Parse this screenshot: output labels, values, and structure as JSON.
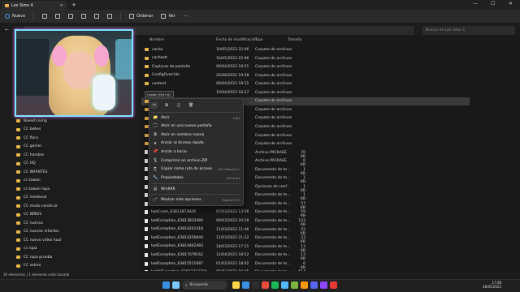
{
  "window": {
    "tab_title": "Los Sims 4",
    "tab_close": "✕",
    "new_tab": "+",
    "minimize": "—",
    "maximize": "☐",
    "close": "✕"
  },
  "commandbar": {
    "new_label": "Nuevo",
    "sort_label": "Ordenar",
    "view_label": "Ver",
    "more_label": "···"
  },
  "address": {
    "path": "",
    "search_placeholder": "Buscar en Los Sims 4"
  },
  "columns": {
    "name": "Nombre",
    "date": "Fecha de modificación",
    "type": "Tipo",
    "size": "Tamaño"
  },
  "sidebar": {
    "items": [
      "Boxed Living",
      "CC bebes",
      "CC flora",
      "CC gamer",
      "CC hombre",
      "CC HQ",
      "CC INFANTES",
      "cc kawaii",
      "cc kawaii ropa",
      "CC medieval",
      "CC modo construir",
      "CC NIÑOS",
      "CC nuevos",
      "CC nuevos infantes",
      "CC nuevo video haul",
      "cc ropa",
      "CC ropa prueba",
      "CC solero"
    ]
  },
  "files": [
    {
      "name": "cache",
      "date": "10/05/2023 22:06",
      "type": "Carpeta de archivos",
      "size": "",
      "kind": "folder"
    },
    {
      "name": "cachestr",
      "date": "10/05/2023 22:06",
      "type": "Carpeta de archivos",
      "size": "",
      "kind": "folder"
    },
    {
      "name": "Capturas de pantalla",
      "date": "06/04/2023 18:51",
      "type": "Carpeta de archivos",
      "size": "",
      "kind": "folder"
    },
    {
      "name": "ConfigOverride",
      "date": "26/08/2022 19:58",
      "type": "Carpeta de archivos",
      "size": "",
      "kind": "folder"
    },
    {
      "name": "content",
      "date": "06/04/2023 18:51",
      "type": "Carpeta de archivos",
      "size": "",
      "kind": "folder"
    },
    {
      "name": "",
      "date": "10/04/2023 16:27",
      "type": "Carpeta de archivos",
      "size": "",
      "kind": "folder"
    },
    {
      "name": "",
      "date": "",
      "type": "Carpeta de archivos",
      "size": "",
      "kind": "folder"
    },
    {
      "name": "",
      "date": "",
      "type": "Carpeta de archivos",
      "size": "",
      "kind": "folder"
    },
    {
      "name": "",
      "date": "",
      "type": "Carpeta de archivos",
      "size": "",
      "kind": "folder"
    },
    {
      "name": "",
      "date": "",
      "type": "Carpeta de archivos",
      "size": "",
      "kind": "folder"
    },
    {
      "name": "",
      "date": "",
      "type": "Carpeta de archivos",
      "size": "",
      "kind": "folder"
    },
    {
      "name": "",
      "date": "",
      "type": "Carpeta de archivos",
      "size": "",
      "kind": "folder"
    },
    {
      "name": "",
      "date": "",
      "type": "Archivo PACKAGE",
      "size": "70 KB",
      "kind": "doc"
    },
    {
      "name": "",
      "date": "",
      "type": "Archivo PACKAGE",
      "size": "6 KB",
      "kind": "doc"
    },
    {
      "name": "",
      "date": "",
      "type": "Documento de te...",
      "size": "1 KB",
      "kind": "doc"
    },
    {
      "name": "",
      "date": "",
      "type": "Documento de te...",
      "size": "1 KB",
      "kind": "doc"
    },
    {
      "name": "",
      "date": "",
      "type": "Opciones de conf...",
      "size": "1 KB",
      "kind": "doc"
    },
    {
      "name": "",
      "date": "",
      "type": "Documento de te...",
      "size": "1 KB",
      "kind": "doc"
    },
    {
      "name": "",
      "date": "",
      "type": "Documento de te...",
      "size": "57 KB",
      "kind": "doc"
    },
    {
      "name": "lastCrash_63813873929",
      "date": "07/03/2023 13:56",
      "type": "Documento de te...",
      "size": "59 KB",
      "kind": "doc"
    },
    {
      "name": "lastException_63813833484",
      "date": "06/03/2023 20:28",
      "type": "Documento de te...",
      "size": "133 KB",
      "kind": "doc"
    },
    {
      "name": "lastException_63814241418",
      "date": "11/03/2023 11:46",
      "type": "Documento de te...",
      "size": "22 KB",
      "kind": "doc"
    },
    {
      "name": "lastException_63814250844",
      "date": "11/03/2023 21:22",
      "type": "Documento de te...",
      "size": "23 KB",
      "kind": "doc"
    },
    {
      "name": "lastException_63814842483",
      "date": "18/03/2023 17:51",
      "type": "Documento de te...",
      "size": "13 KB",
      "kind": "doc"
    },
    {
      "name": "lastException_63817079162",
      "date": "12/04/2023 18:52",
      "type": "Documento de te...",
      "size": "13 KB",
      "kind": "doc"
    },
    {
      "name": "lastException_63815511087",
      "date": "01/02/2023 18:02",
      "type": "Documento de te...",
      "size": "6 KB",
      "kind": "doc"
    },
    {
      "name": "lastUIException_63813733224",
      "date": "05/03/2023 16:45",
      "type": "Documento de te...",
      "size": "514 KB",
      "kind": "doc"
    }
  ],
  "context_menu": {
    "tooltip": "Cortar (Ctrl+X)",
    "tools": [
      "✂",
      "⧉",
      "◫",
      "🗑"
    ],
    "items": [
      {
        "icon": "📁",
        "label": "Abrir",
        "shortcut": "Intro"
      },
      {
        "icon": "🗔",
        "label": "Abrir en una nueva pestaña",
        "shortcut": ""
      },
      {
        "icon": "⧉",
        "label": "Abrir en ventana nueva",
        "shortcut": ""
      },
      {
        "icon": "★",
        "label": "Anclar al Acceso rápido",
        "shortcut": ""
      },
      {
        "icon": "📌",
        "label": "Anclar a Inicio",
        "shortcut": ""
      },
      {
        "icon": "🗜",
        "label": "Comprimir en archivo ZIP",
        "shortcut": ""
      },
      {
        "icon": "⎘",
        "label": "Copiar como ruta de acceso",
        "shortcut": "Ctrl+Mayús+C"
      },
      {
        "icon": "🔧",
        "label": "Propiedades",
        "shortcut": "Alt+Intro"
      },
      {
        "icon": "▤",
        "label": "WinRAR",
        "shortcut": "›"
      },
      {
        "icon": "⤢",
        "label": "Mostrar más opciones",
        "shortcut": "Mayús+F10"
      }
    ]
  },
  "status": {
    "text": "30 elementos  |  1 elemento seleccionado"
  },
  "taskbar": {
    "search_label": "Búsqueda",
    "time": "17:08",
    "date": "28/05/2023",
    "icon_colors": [
      "#ffd54a",
      "#3a8ee6",
      "#2d2d2d",
      "#e94b3c",
      "#1db954",
      "#4fb8ff",
      "#7cb342",
      "#ff9800",
      "#5865f2",
      "#9146ff",
      "#e53935"
    ]
  }
}
